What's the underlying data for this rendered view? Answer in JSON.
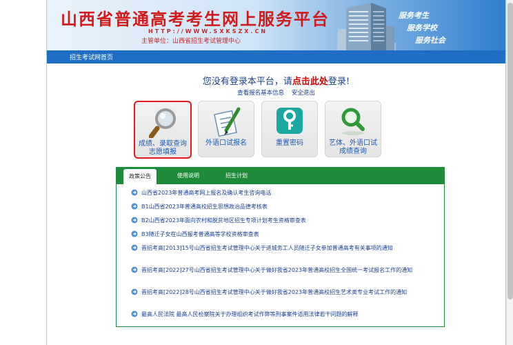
{
  "header": {
    "title": "山西省普通高考考生网上服务平台",
    "url": "HTTP://WWW.SXKSZX.CN",
    "sponsor": "主管单位：山西省招生考试管理中心",
    "slogans": [
      "服务考生",
      "服务学校",
      "服务社会"
    ]
  },
  "nav": {
    "home_link": "招生考试网首页"
  },
  "login_notice": {
    "before": "您没有登录本平台，请",
    "link": "点击此处",
    "after": "登录!"
  },
  "sublinks": [
    "查看报名基本信息",
    "安全退出"
  ],
  "tiles": [
    {
      "line1": "成绩、录取查询",
      "line2": "志愿填报",
      "icon": "magnifier-icon",
      "selected": true
    },
    {
      "line1": "外语口试报名",
      "line2": "",
      "icon": "document-pen-icon",
      "selected": false
    },
    {
      "line1": "重置密码",
      "line2": "",
      "icon": "key-icon",
      "selected": false
    },
    {
      "line1": "艺体、外语口试",
      "line2": "成绩查询",
      "icon": "search-icon",
      "selected": false
    }
  ],
  "tabs": [
    "政策公告",
    "使用说明",
    "招生计划"
  ],
  "active_tab": 0,
  "news": [
    "山西省2023年普通高考网上报名及确认考生咨询电话",
    "B1山西省2023年普通高校招生思想政治品德考核表",
    "B2山西省2023年面向农村和脱贫地区招生专项计划考生资格审查表",
    "B3随迁子女在山西报考普通高等学校资格审查表",
    "晋招考高[2013]15号山西省招生考试管理中心关于进城务工人员随迁子女参加普通高考有关事项的通知",
    "晋招考高[2022]27号山西省招生考试管理中心关于做好我省2023年普通高校招生全国统一考试报名工作的通知",
    "晋招考高[2022]28号山西省招生考试管理中心关于做好我省2023年普通高校招生艺术类专业考试工作的通知",
    "最高人民法院 最高人民检察院关于办理组织考试作弊等刑事案件适用法律若干问题的解释"
  ],
  "colors": {
    "title_red": "#d11a1a",
    "nav_blue": "#1e6fc4",
    "tab_green": "#1e8b3a",
    "link_blue": "#1a3f8f",
    "tile_label_blue": "#1e5bb5",
    "highlight_red": "#e41a1a"
  }
}
